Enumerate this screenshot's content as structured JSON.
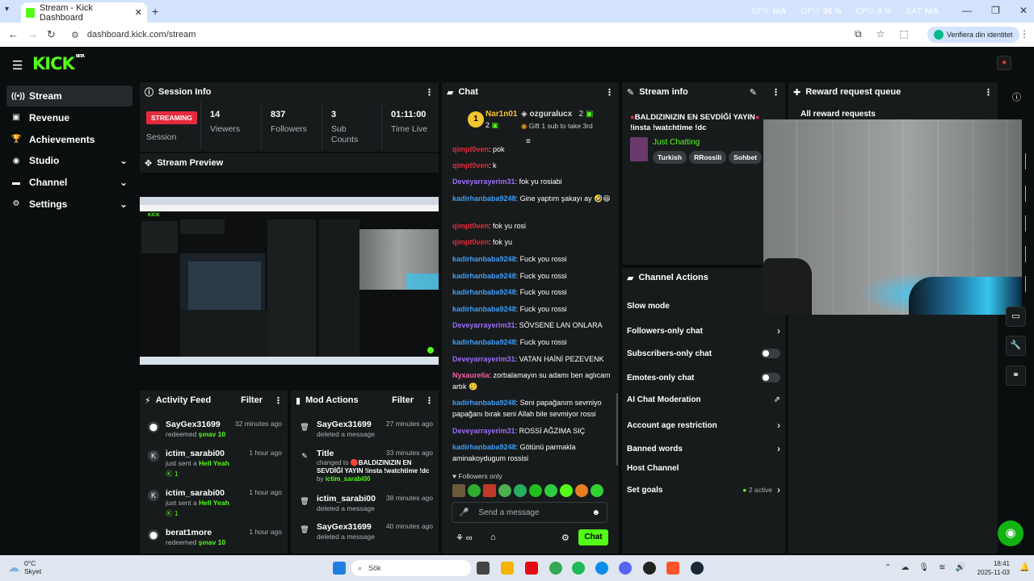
{
  "browser": {
    "tab_title": "Stream - Kick Dashboard",
    "url": "dashboard.kick.com/stream",
    "profile_label": "Verifiera din identitet",
    "perf": {
      "eps_label": "EPS:",
      "eps_value": "N/A",
      "gpu_label": "GPU:",
      "gpu_value": "36 %",
      "cpu_label": "CPU:",
      "cpu_value": "0 %",
      "bat_label": "BAT:",
      "bat_value": "N/A"
    }
  },
  "app": {
    "logo": "KICK",
    "logo_sup": "BETA",
    "sidebar": [
      {
        "label": "Stream",
        "icon": "stream-icon",
        "active": true
      },
      {
        "label": "Revenue",
        "icon": "revenue-icon"
      },
      {
        "label": "Achievements",
        "icon": "trophy-icon"
      },
      {
        "label": "Studio",
        "icon": "studio-icon",
        "chevron": true
      },
      {
        "label": "Channel",
        "icon": "channel-icon",
        "chevron": true
      },
      {
        "label": "Settings",
        "icon": "gear-icon",
        "chevron": true
      }
    ],
    "session": {
      "title": "Session Info",
      "status": "STREAMING",
      "status_label": "Session",
      "stats": [
        {
          "value": "14",
          "label": "Viewers"
        },
        {
          "value": "837",
          "label": "Followers"
        },
        {
          "value": "3",
          "label": "Sub Counts"
        },
        {
          "value": "01:11:00",
          "label": "Time Live"
        }
      ]
    },
    "preview": {
      "title": "Stream Preview"
    },
    "activity": {
      "title": "Activity Feed",
      "filter": "Filter",
      "items": [
        {
          "name": "SayGex31699",
          "time": "32 minutes ago",
          "text": "redeemed",
          "highlight": "şınav 10"
        },
        {
          "name": "ictim_sarabi00",
          "time": "1 hour ago",
          "text": "just sent a",
          "highlight": "Hell Yeah",
          "count": "1"
        },
        {
          "name": "ictim_sarabi00",
          "time": "1 hour ago",
          "text": "just sent a",
          "highlight": "Hell Yeah",
          "count": "1"
        },
        {
          "name": "berat1more",
          "time": "1 hour ago",
          "text": "redeemed",
          "highlight": "şınav 10"
        }
      ]
    },
    "mod": {
      "title": "Mod Actions",
      "filter": "Filter",
      "items": [
        {
          "name": "SayGex31699",
          "time": "27 minutes ago",
          "text": "deleted a message"
        },
        {
          "name": "Title",
          "time": "33 minutes ago",
          "text": "changed to",
          "title_value": "BALDIZINIZIN EN SEVDİĞİ YAYIN",
          "title_value2": "!insta !watchtime !dc",
          "by": "by",
          "by_user": "ictim_sarabi00"
        },
        {
          "name": "ictim_sarabi00",
          "time": "38 minutes ago",
          "text": "deleted a message"
        },
        {
          "name": "SayGex31699",
          "time": "40 minutes ago",
          "text": "deleted a message"
        }
      ]
    },
    "chat": {
      "title": "Chat",
      "pinned_user": "Nar1n01",
      "pinned_rank": "1",
      "pinned_count": "2",
      "gift_user": "ozguralucx",
      "gift_count": "2",
      "gift_text": "Gift 1 sub to take 3rd",
      "messages": [
        {
          "user": "qimpt0ven",
          "color": "red",
          "text": "pok"
        },
        {
          "user": "qimpt0ven",
          "color": "red",
          "text": "k"
        },
        {
          "user": "Deveyarrayerim31",
          "color": "purple",
          "text": "fok yu rosiabi"
        },
        {
          "user": "kadirhanbaba9248",
          "color": "blue",
          "text": "Gine yaptım şakayı ay 🤣😆"
        },
        {
          "user": "qimpt0ven",
          "color": "red",
          "text": "fok yu rosi"
        },
        {
          "user": "qimpt0ven",
          "color": "red",
          "text": "fok yu"
        },
        {
          "user": "kadirhanbaba9248",
          "color": "blue",
          "text": "Fuck you rossi"
        },
        {
          "user": "kadirhanbaba9248",
          "color": "blue",
          "text": "Fuck you rossi"
        },
        {
          "user": "kadirhanbaba9248",
          "color": "blue",
          "text": "Fuck you rossi"
        },
        {
          "user": "kadirhanbaba9248",
          "color": "blue",
          "text": "Fuck you rossi"
        },
        {
          "user": "Deveyarrayerim31",
          "color": "purple",
          "text": "SÖVSENE LAN ONLARA"
        },
        {
          "user": "kadirhanbaba9248",
          "color": "blue",
          "text": "Fuck you rossi"
        },
        {
          "user": "Deveyarrayerim31",
          "color": "purple",
          "text": "VATAN HAİNİ PEZEVENK"
        },
        {
          "user": "Nyxaurelia",
          "color": "pink",
          "text": "zorbalamayın su adamı ben aglıcam artık 🥲"
        },
        {
          "user": "kadirhanbaba9248",
          "color": "blue",
          "text": "Seni papağanım sevmiyo papağanı bırak seni Allah bile sevmiyor rossi"
        },
        {
          "user": "Deveyarrayerim31",
          "color": "purple",
          "text": "ROSSİ AĞZIMA SIÇ"
        },
        {
          "user": "kadirhanbaba9248",
          "color": "blue",
          "text": "Götünü parmakla aminakoydugum rossisi"
        }
      ],
      "followers_only": "Followers only",
      "placeholder": "Send a message",
      "send": "Chat"
    },
    "stream_info": {
      "title": "Stream info",
      "stream_title": "BALDIZINIZIN EN SEVDİĞİ YAYIN",
      "stream_title2": "!insta !watchtime !dc",
      "category": "Just Chatting",
      "tags": [
        "Turkish",
        "RRossili",
        "Sohbet"
      ]
    },
    "channel_actions": {
      "title": "Channel Actions",
      "items": [
        {
          "label": "Slow mode",
          "type": "none"
        },
        {
          "label": "Followers-only chat",
          "type": "chevron"
        },
        {
          "label": "Subscribers-only chat",
          "type": "toggle"
        },
        {
          "label": "Emotes-only chat",
          "type": "toggle"
        },
        {
          "label": "AI Chat Moderation",
          "type": "external"
        },
        {
          "label": "Account age restriction",
          "type": "chevron"
        },
        {
          "label": "Banned words",
          "type": "chevron"
        },
        {
          "label": "Host Channel",
          "type": "none"
        },
        {
          "label": "Set goals",
          "type": "chevron",
          "status": "2 active"
        }
      ]
    },
    "reward": {
      "title": "Reward request queue",
      "all": "All reward requests"
    }
  },
  "taskbar": {
    "temp": "0°C",
    "weather": "Skyet",
    "search": "Sök",
    "time": "18:41",
    "date": "2025-11-03"
  }
}
